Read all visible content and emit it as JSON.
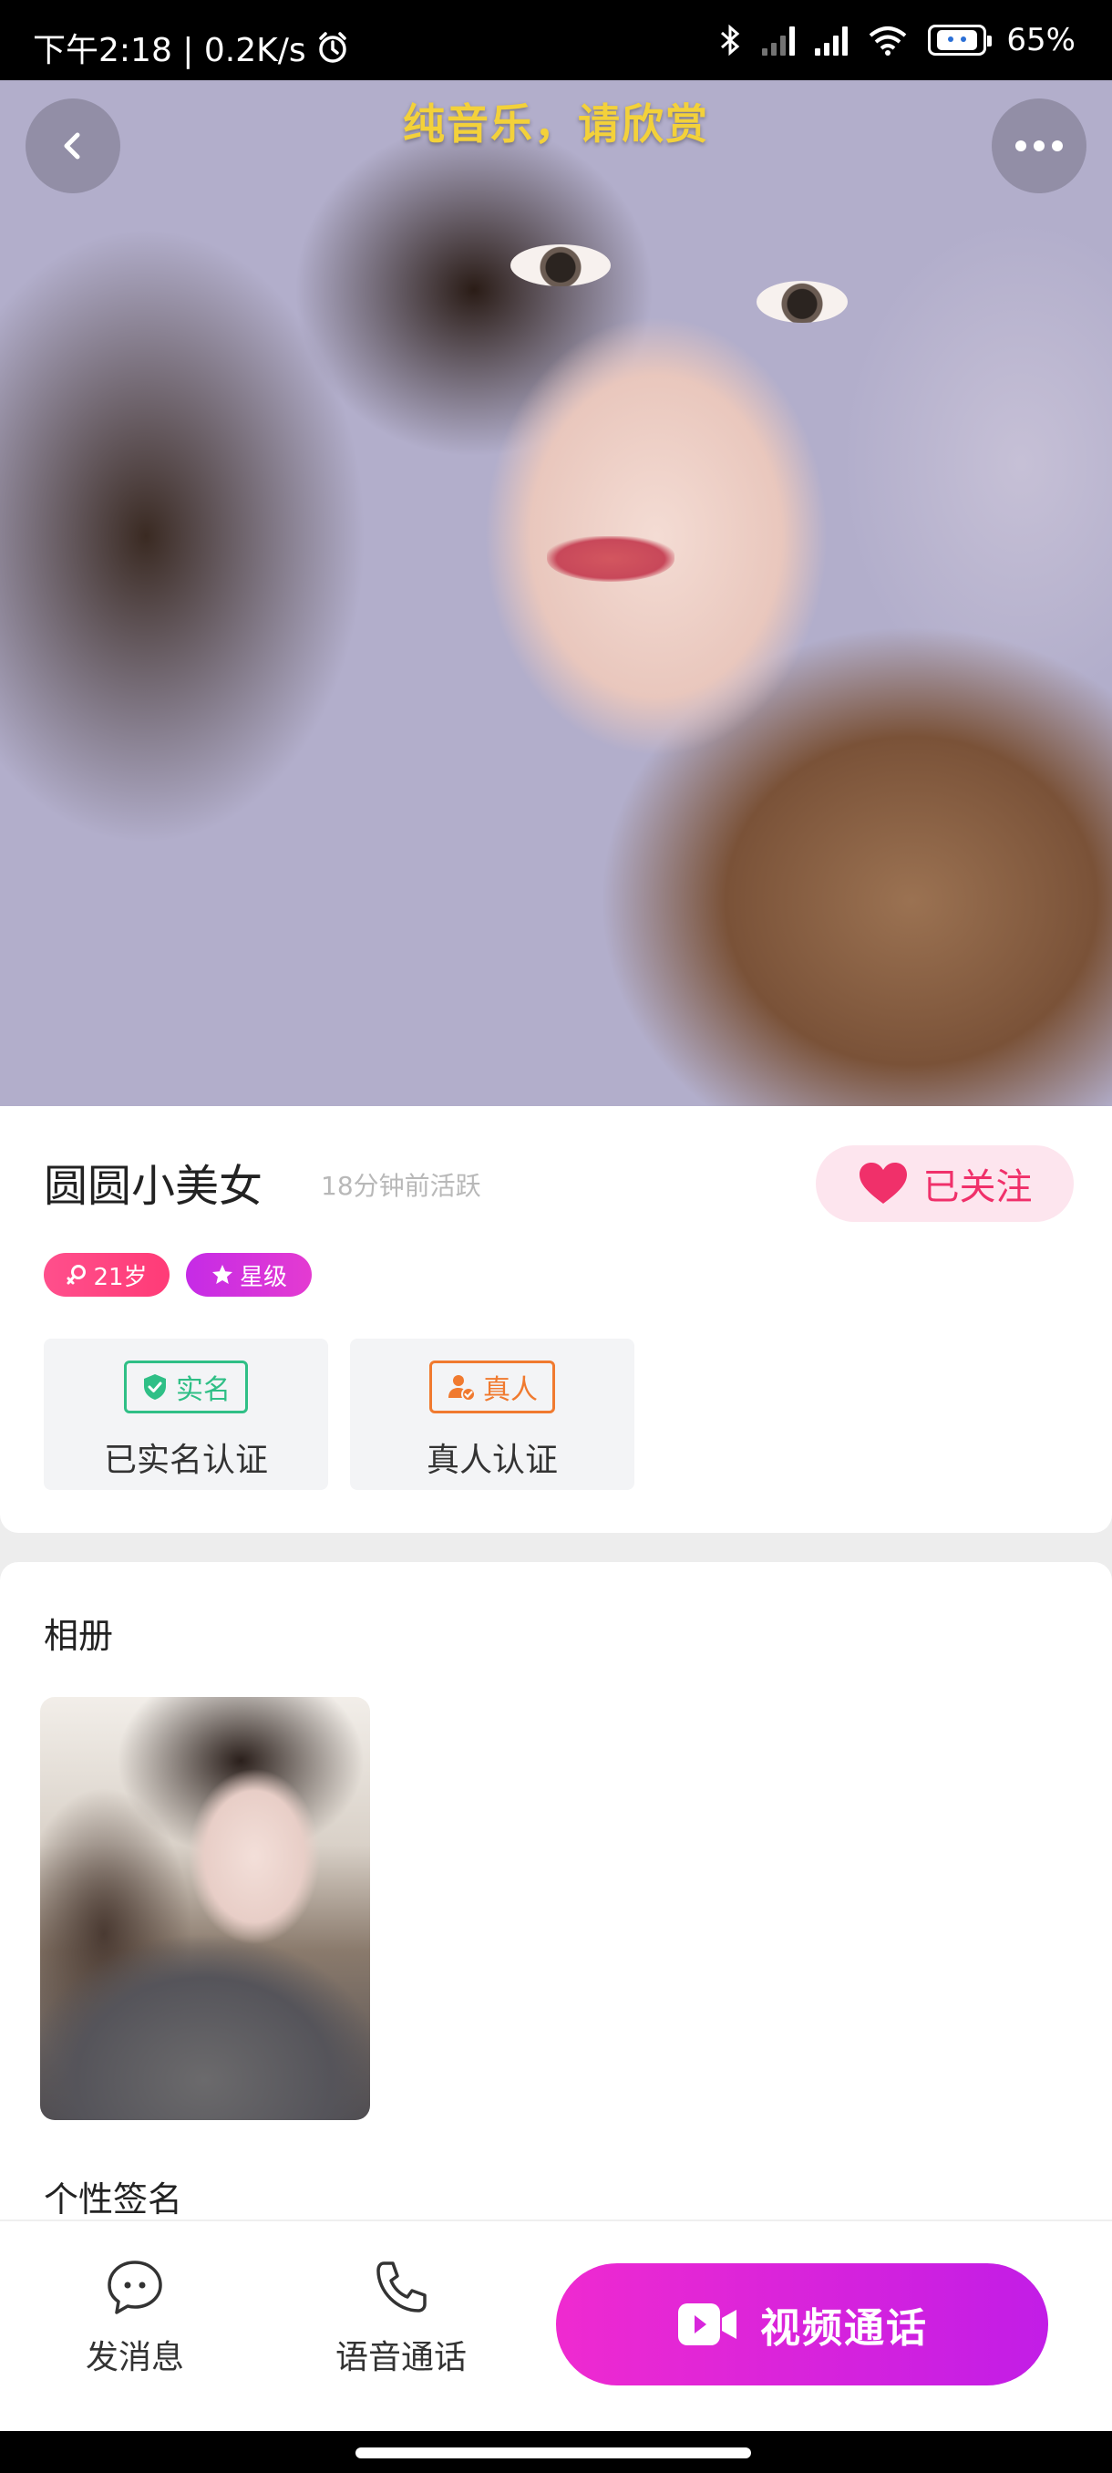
{
  "status_bar": {
    "time_speed": "下午2:18 | 0.2K/s",
    "battery": "65%",
    "icons": [
      "alarm-icon",
      "bluetooth-icon",
      "signal-icon",
      "signal-icon",
      "wifi-icon",
      "battery-icon"
    ]
  },
  "hero": {
    "caption": "纯音乐，请欣赏",
    "icons": [
      "back-icon",
      "more-icon"
    ]
  },
  "profile": {
    "name": "圆圆小美女",
    "active": "18分钟前活跃",
    "follow_label": "已关注",
    "tags": {
      "age": "21岁",
      "level": "星级"
    },
    "verifications": [
      {
        "badge": "实名",
        "label": "已实名认证"
      },
      {
        "badge": "真人",
        "label": "真人认证"
      }
    ]
  },
  "album": {
    "title": "相册",
    "signature_title": "个性签名"
  },
  "actions": {
    "message": "发消息",
    "voice_call": "语音通话",
    "video_call": "视频通话"
  },
  "colors": {
    "accent_pink": "#f0306a",
    "video_gradient": [
      "#ef2ad0",
      "#c21de6"
    ],
    "verify_green": "#2fbf86",
    "verify_orange": "#f07a2f",
    "caption_yellow": "#f3d13a"
  }
}
